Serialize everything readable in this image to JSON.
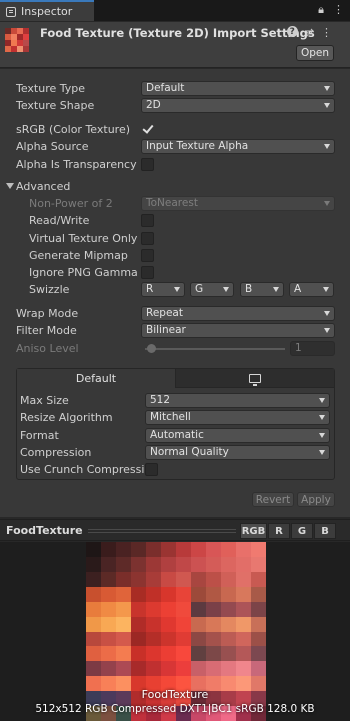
{
  "tab": {
    "label": "Inspector"
  },
  "header": {
    "title": "Food Texture (Texture 2D) Import Settings",
    "open_label": "Open"
  },
  "props": {
    "texture_type": {
      "label": "Texture Type",
      "value": "Default"
    },
    "texture_shape": {
      "label": "Texture Shape",
      "value": "2D"
    },
    "srgb": {
      "label": "sRGB (Color Texture)",
      "checked": true
    },
    "alpha_source": {
      "label": "Alpha Source",
      "value": "Input Texture Alpha"
    },
    "alpha_transparency": {
      "label": "Alpha Is Transparency",
      "checked": false
    }
  },
  "advanced": {
    "label": "Advanced",
    "npot": {
      "label": "Non-Power of 2",
      "value": "ToNearest"
    },
    "read_write": {
      "label": "Read/Write"
    },
    "virtual_texture": {
      "label": "Virtual Texture Only"
    },
    "mipmap": {
      "label": "Generate Mipmap"
    },
    "ignore_png_gamma": {
      "label": "Ignore PNG Gamma"
    },
    "swizzle": {
      "label": "Swizzle",
      "r": "R",
      "g": "G",
      "b": "B",
      "a": "A"
    }
  },
  "wrap": {
    "label": "Wrap Mode",
    "value": "Repeat"
  },
  "filter": {
    "label": "Filter Mode",
    "value": "Bilinear"
  },
  "aniso": {
    "label": "Aniso Level",
    "value": "1"
  },
  "platform": {
    "tab_default": "Default",
    "max_size": {
      "label": "Max Size",
      "value": "512"
    },
    "resize": {
      "label": "Resize Algorithm",
      "value": "Mitchell"
    },
    "format": {
      "label": "Format",
      "value": "Automatic"
    },
    "compression": {
      "label": "Compression",
      "value": "Normal Quality"
    },
    "crunch": {
      "label": "Use Crunch Compression"
    }
  },
  "buttons": {
    "revert": "Revert",
    "apply": "Apply"
  },
  "preview": {
    "title": "FoodTexture",
    "channels": [
      "RGB",
      "R",
      "G",
      "B"
    ],
    "name": "FoodTexture",
    "info": "512x512  RGB Compressed DXT1|BC1 sRGB  128.0 KB"
  },
  "colors": {
    "accent": "#3a79bb",
    "panel": "#383838",
    "field": "#505050"
  }
}
